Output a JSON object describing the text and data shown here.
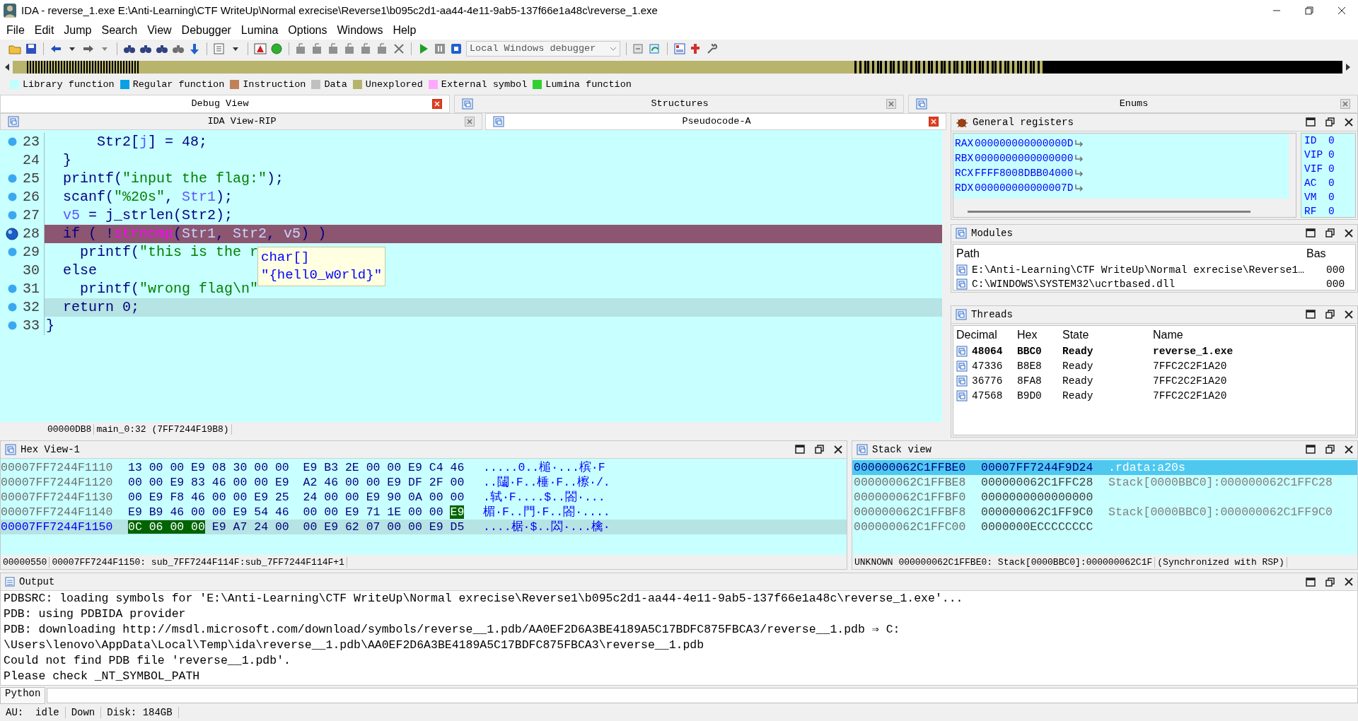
{
  "window": {
    "title": "IDA - reverse_1.exe E:\\Anti-Learning\\CTF WriteUp\\Normal exrecise\\Reverse1\\b095c2d1-aa44-4e11-9ab5-137f66e1a48c\\reverse_1.exe"
  },
  "menu": [
    "File",
    "Edit",
    "Jump",
    "Search",
    "View",
    "Debugger",
    "Lumina",
    "Options",
    "Windows",
    "Help"
  ],
  "toolbar": {
    "debugger": "Local Windows debugger"
  },
  "legend": [
    {
      "label": "Library function",
      "color": "#c0ffff"
    },
    {
      "label": "Regular function",
      "color": "#0aa0e6"
    },
    {
      "label": "Instruction",
      "color": "#c0805a"
    },
    {
      "label": "Data",
      "color": "#c0c0c0"
    },
    {
      "label": "Unexplored",
      "color": "#b4b46c"
    },
    {
      "label": "External symbol",
      "color": "#ffa8ff"
    },
    {
      "label": "Lumina function",
      "color": "#30d030"
    }
  ],
  "top_tabs": [
    {
      "label": "Debug View",
      "selected": true
    },
    {
      "label": "Structures",
      "selected": false
    },
    {
      "label": "Enums",
      "selected": false
    }
  ],
  "views": [
    {
      "label": "IDA View-RIP",
      "selected": false
    },
    {
      "label": "Pseudocode-A",
      "selected": true
    }
  ],
  "code": {
    "lines": [
      {
        "number": "23",
        "breakpoint": true,
        "current": false,
        "highlighted": false,
        "segments": [
          {
            "text": "      Str2[",
            "kind": "plain"
          },
          {
            "text": "j",
            "kind": "var"
          },
          {
            "text": "] = 48;",
            "kind": "plain"
          }
        ]
      },
      {
        "number": "24",
        "breakpoint": false,
        "current": false,
        "highlighted": false,
        "segments": [
          {
            "text": "  }",
            "kind": "plain"
          }
        ]
      },
      {
        "number": "25",
        "breakpoint": true,
        "current": false,
        "highlighted": false,
        "segments": [
          {
            "text": "  printf(",
            "kind": "plain"
          },
          {
            "text": "\"input the flag:\"",
            "kind": "string"
          },
          {
            "text": ");",
            "kind": "plain"
          }
        ]
      },
      {
        "number": "26",
        "breakpoint": true,
        "current": false,
        "highlighted": false,
        "segments": [
          {
            "text": "  scanf(",
            "kind": "plain"
          },
          {
            "text": "\"%20s\"",
            "kind": "string"
          },
          {
            "text": ", ",
            "kind": "plain"
          },
          {
            "text": "Str1",
            "kind": "var"
          },
          {
            "text": ");",
            "kind": "plain"
          }
        ]
      },
      {
        "number": "27",
        "breakpoint": true,
        "current": false,
        "highlighted": false,
        "segments": [
          {
            "text": "  v5",
            "kind": "var"
          },
          {
            "text": " = j_strlen(Str2);",
            "kind": "plain"
          }
        ]
      },
      {
        "number": "28",
        "breakpoint": true,
        "current": true,
        "highlighted": false,
        "segments": [
          {
            "text": "  if ( !",
            "kind": "plain"
          },
          {
            "text": "strncmp",
            "kind": "call"
          },
          {
            "text": "(",
            "kind": "plain"
          },
          {
            "text": "Str1",
            "kind": "var"
          },
          {
            "text": ", ",
            "kind": "plain"
          },
          {
            "text": "Str2",
            "kind": "var"
          },
          {
            "text": ", ",
            "kind": "plain"
          },
          {
            "text": "v5",
            "kind": "var"
          },
          {
            "text": ") )",
            "kind": "plain"
          }
        ]
      },
      {
        "number": "29",
        "breakpoint": true,
        "current": false,
        "highlighted": false,
        "segments": [
          {
            "text": "    printf(",
            "kind": "plain"
          },
          {
            "text": "\"this is the r",
            "kind": "string"
          }
        ]
      },
      {
        "number": "30",
        "breakpoint": false,
        "current": false,
        "highlighted": false,
        "segments": [
          {
            "text": "  else",
            "kind": "plain"
          }
        ]
      },
      {
        "number": "31",
        "breakpoint": true,
        "current": false,
        "highlighted": false,
        "segments": [
          {
            "text": "    printf(",
            "kind": "plain"
          },
          {
            "text": "\"wrong flag\\n\"",
            "kind": "string"
          }
        ]
      },
      {
        "number": "32",
        "breakpoint": true,
        "current": false,
        "highlighted": true,
        "segments": [
          {
            "text": "  return 0;",
            "kind": "plain"
          }
        ]
      },
      {
        "number": "33",
        "breakpoint": true,
        "current": false,
        "highlighted": false,
        "segments": [
          {
            "text": "}",
            "kind": "plain"
          }
        ]
      }
    ],
    "tooltip": [
      "char[]",
      "\"{hell0_w0rld}\""
    ],
    "status": [
      "00000DB8",
      "main_0:32 (7FF7244F19B8)"
    ]
  },
  "registers": {
    "title": "General registers",
    "rows": [
      {
        "name": "RAX",
        "value": "000000000000000D"
      },
      {
        "name": "RBX",
        "value": "0000000000000000"
      },
      {
        "name": "RCX",
        "value": "FFFF8008DBB04000"
      },
      {
        "name": "RDX",
        "value": "000000000000007D"
      }
    ],
    "flags": [
      {
        "name": "ID",
        "value": "0"
      },
      {
        "name": "VIP",
        "value": "0"
      },
      {
        "name": "VIF",
        "value": "0"
      },
      {
        "name": "AC",
        "value": "0"
      },
      {
        "name": "VM",
        "value": "0"
      },
      {
        "name": "RF",
        "value": "0"
      }
    ]
  },
  "modules": {
    "title": "Modules",
    "columns": [
      "Path",
      "Bas"
    ],
    "rows": [
      {
        "path": "E:\\Anti-Learning\\CTF WriteUp\\Normal exrecise\\Reverse1…",
        "base": "000"
      },
      {
        "path": "C:\\WINDOWS\\SYSTEM32\\ucrtbased.dll",
        "base": "000"
      }
    ]
  },
  "threads": {
    "title": "Threads",
    "columns": [
      "Decimal",
      "Hex",
      "State",
      "Name"
    ],
    "rows": [
      {
        "decimal": "48064",
        "hex": "BBC0",
        "state": "Ready",
        "name": "reverse_1.exe",
        "current": true
      },
      {
        "decimal": "47336",
        "hex": "B8E8",
        "state": "Ready",
        "name": "7FFC2C2F1A20",
        "current": false
      },
      {
        "decimal": "36776",
        "hex": "8FA8",
        "state": "Ready",
        "name": "7FFC2C2F1A20",
        "current": false
      },
      {
        "decimal": "47568",
        "hex": "B9D0",
        "state": "Ready",
        "name": "7FFC2C2F1A20",
        "current": false
      }
    ]
  },
  "hex_view": {
    "title": "Hex View-1",
    "rows": [
      {
        "address": "00007FF7244F1110",
        "selected": false,
        "bytes": [
          {
            "text": "13 00 00 E9 08 30 00 00  E9 B3 2E 00 00 E9 C4 46",
            "marked": false
          }
        ],
        "ascii": ".....0..槌·...槟·F"
      },
      {
        "address": "00007FF7244F1120",
        "selected": false,
        "bytes": [
          {
            "text": "00 00 E9 83 46 00 00 E9  A2 46 00 00 E9 DF 2F 00",
            "marked": false
          }
        ],
        "ascii": "..闧·F..棰·F..檫·/."
      },
      {
        "address": "00007FF7244F1130",
        "selected": false,
        "bytes": [
          {
            "text": "00 E9 F8 46 00 00 E9 25  24 00 00 E9 90 0A 00 00",
            "marked": false
          }
        ],
        "ascii": ".轼·F....$..閤·..."
      },
      {
        "address": "00007FF7244F1140",
        "selected": false,
        "bytes": [
          {
            "text": "E9 B9 46 00 00 E9 54 46  00 00 E9 71 1E 00 00 ",
            "marked": false
          },
          {
            "text": "E9",
            "marked": true
          }
        ],
        "ascii": "楣·F..門·F..閤·...."
      },
      {
        "address": "00007FF7244F1150",
        "selected": true,
        "bytes": [
          {
            "text": "0C 06 00 00",
            "marked": true
          },
          {
            "text": " E9 A7 24 00  00 E9 62 07 00 00 E9 D5",
            "marked": false
          }
        ],
        "ascii": "....椐·$..閦·...檎·"
      }
    ],
    "status": [
      "00000550",
      "00007FF7244F1150: sub_7FF7244F114F:sub_7FF7244F114F+1"
    ]
  },
  "stack_view": {
    "title": "Stack view",
    "rows": [
      {
        "address": "000000062C1FFBE0",
        "value": "00007FF7244F9D24",
        "comment": ".rdata:a20s",
        "selected": true
      },
      {
        "address": "000000062C1FFBE8",
        "value": "000000062C1FFC28",
        "comment": "Stack[0000BBC0]:000000062C1FFC28",
        "selected": false
      },
      {
        "address": "000000062C1FFBF0",
        "value": "0000000000000000",
        "selected": false
      },
      {
        "address": "000000062C1FFBF8",
        "value": "000000062C1FF9C0",
        "comment": "Stack[0000BBC0]:000000062C1FF9C0",
        "selected": false
      },
      {
        "address": "000000062C1FFC00",
        "value": "0000000ECCCCCCCC",
        "selected": false
      }
    ],
    "status": [
      "UNKNOWN 000000062C1FFBE0: Stack[0000BBC0]:000000062C1F",
      "(Synchronized with RSP)"
    ]
  },
  "output": {
    "title": "Output",
    "lines": [
      "PDBSRC: loading symbols for 'E:\\Anti-Learning\\CTF WriteUp\\Normal exrecise\\Reverse1\\b095c2d1-aa44-4e11-9ab5-137f66e1a48c\\reverse_1.exe'...",
      "PDB: using PDBIDA provider",
      "PDB: downloading http://msdl.microsoft.com/download/symbols/reverse__1.pdb/AA0EF2D6A3BE4189A5C17BDFC875FBCA3/reverse__1.pdb ⇒ C:",
      "\\Users\\lenovo\\AppData\\Local\\Temp\\ida\\reverse__1.pdb\\AA0EF2D6A3BE4189A5C17BDFC875FBCA3\\reverse__1.pdb",
      "Could not find PDB file 'reverse__1.pdb'.",
      "Please check _NT_SYMBOL_PATH"
    ]
  },
  "command": {
    "language": "Python"
  },
  "status_bar": [
    "AU:  idle",
    "Down",
    "Disk: 184GB"
  ]
}
